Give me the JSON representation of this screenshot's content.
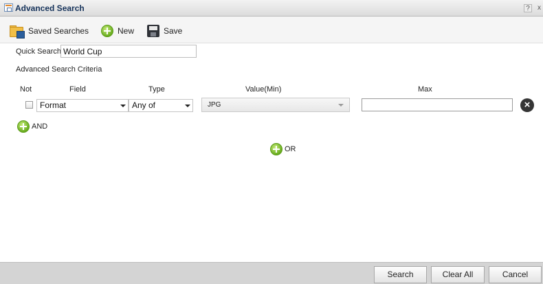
{
  "window": {
    "title": "Advanced Search",
    "help_label": "?",
    "close_label": "x"
  },
  "toolbar": {
    "saved_searches_label": "Saved Searches",
    "new_label": "New",
    "save_label": "Save"
  },
  "quick_search": {
    "label": "Quick Search",
    "value": "World Cup"
  },
  "criteria": {
    "section_label": "Advanced Search Criteria",
    "headers": {
      "not": "Not",
      "field": "Field",
      "type": "Type",
      "value_min": "Value(Min)",
      "max": "Max"
    },
    "rows": [
      {
        "not_checked": false,
        "field": "Format",
        "type": "Any of",
        "value_min": "JPG",
        "max": ""
      }
    ],
    "and_label": "AND",
    "or_label": "OR"
  },
  "footer": {
    "search_label": "Search",
    "clear_all_label": "Clear All",
    "cancel_label": "Cancel"
  },
  "icons": {
    "title": "search-window-icon",
    "saved_searches": "folder-save-icon",
    "new": "plus-circle-icon",
    "save": "floppy-disk-icon",
    "remove_row": "close-circle-icon",
    "and": "plus-circle-icon",
    "or": "plus-circle-icon"
  },
  "colors": {
    "accent_green": "#69ad1f",
    "title_text": "#15325a",
    "footer_bg": "#d4d4d4"
  }
}
